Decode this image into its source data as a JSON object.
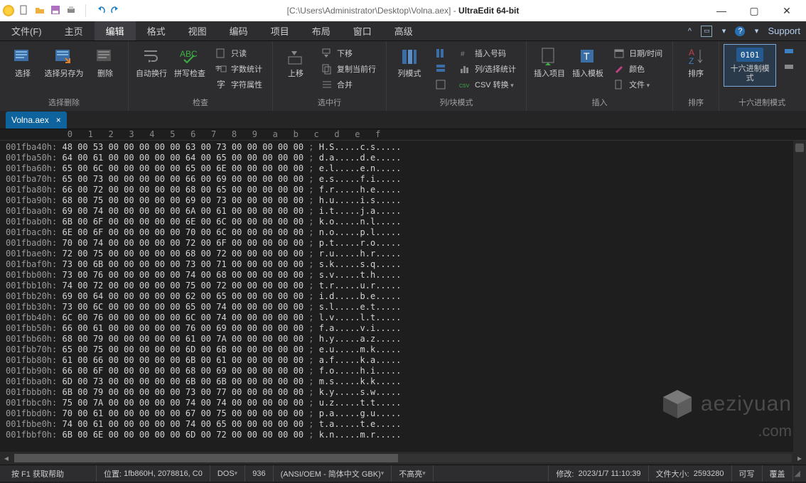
{
  "window": {
    "title_prefix": "[C:\\Users\\Administrator\\Desktop\\Volna.aex] - ",
    "app_name": "UltraEdit 64-bit"
  },
  "menutabs": {
    "items": [
      "文件(F)",
      "主页",
      "编辑",
      "格式",
      "视图",
      "编码",
      "项目",
      "布局",
      "窗口",
      "高级"
    ],
    "active_index": 2,
    "support": "Support"
  },
  "ribbon": {
    "group1": {
      "label": "选择删除",
      "select": "选择",
      "save_sel_as": "选择另存为",
      "delete": "删除"
    },
    "group2": {
      "label": "检查",
      "autowrap": "自动换行",
      "spell": "拼写检查",
      "readonly": "只读",
      "wordcount": "字数统计",
      "fontprop": "字符属性"
    },
    "group3": {
      "label": "选中行",
      "up": "上移",
      "down": "下移",
      "copy_cur": "复制当前行",
      "merge": "合并"
    },
    "group4": {
      "label": "列/块模式",
      "colmode": "列模式",
      "insert_num": "插入号码",
      "col_sel_stat": "列/选择统计",
      "csv_conv": "CSV 转换"
    },
    "group5": {
      "label": "插入",
      "insert_item": "插入项目",
      "insert_tmpl": "插入模板",
      "datetime": "日期/时间",
      "color": "颜色",
      "file": "文件"
    },
    "group6": {
      "label": "排序",
      "sort": "排序"
    },
    "group7": {
      "label": "十六进制模式",
      "hexmode": "十六进制模式",
      "hex_digits": "0101"
    }
  },
  "filetab": {
    "name": "Volna.aex"
  },
  "ruler": "            0   1   2   3   4   5   6   7   8   9   a   b   c   d   e   f",
  "hex_lines": [
    {
      "addr": "001fba40h:",
      "hex": "48 00 53 00 00 00 00 00 63 00 73 00 00 00 00 00",
      "asc": "H.S.....c.s....."
    },
    {
      "addr": "001fba50h:",
      "hex": "64 00 61 00 00 00 00 00 64 00 65 00 00 00 00 00",
      "asc": "d.a.....d.e....."
    },
    {
      "addr": "001fba60h:",
      "hex": "65 00 6C 00 00 00 00 00 65 00 6E 00 00 00 00 00",
      "asc": "e.l.....e.n....."
    },
    {
      "addr": "001fba70h:",
      "hex": "65 00 73 00 00 00 00 00 66 00 69 00 00 00 00 00",
      "asc": "e.s.....f.i....."
    },
    {
      "addr": "001fba80h:",
      "hex": "66 00 72 00 00 00 00 00 68 00 65 00 00 00 00 00",
      "asc": "f.r.....h.e....."
    },
    {
      "addr": "001fba90h:",
      "hex": "68 00 75 00 00 00 00 00 69 00 73 00 00 00 00 00",
      "asc": "h.u.....i.s....."
    },
    {
      "addr": "001fbaa0h:",
      "hex": "69 00 74 00 00 00 00 00 6A 00 61 00 00 00 00 00",
      "asc": "i.t.....j.a....."
    },
    {
      "addr": "001fbab0h:",
      "hex": "6B 00 6F 00 00 00 00 00 6E 00 6C 00 00 00 00 00",
      "asc": "k.o.....n.l....."
    },
    {
      "addr": "001fbac0h:",
      "hex": "6E 00 6F 00 00 00 00 00 70 00 6C 00 00 00 00 00",
      "asc": "n.o.....p.l....."
    },
    {
      "addr": "001fbad0h:",
      "hex": "70 00 74 00 00 00 00 00 72 00 6F 00 00 00 00 00",
      "asc": "p.t.....r.o....."
    },
    {
      "addr": "001fbae0h:",
      "hex": "72 00 75 00 00 00 00 00 68 00 72 00 00 00 00 00",
      "asc": "r.u.....h.r....."
    },
    {
      "addr": "001fbaf0h:",
      "hex": "73 00 6B 00 00 00 00 00 73 00 71 00 00 00 00 00",
      "asc": "s.k.....s.q....."
    },
    {
      "addr": "001fbb00h:",
      "hex": "73 00 76 00 00 00 00 00 74 00 68 00 00 00 00 00",
      "asc": "s.v.....t.h....."
    },
    {
      "addr": "001fbb10h:",
      "hex": "74 00 72 00 00 00 00 00 75 00 72 00 00 00 00 00",
      "asc": "t.r.....u.r....."
    },
    {
      "addr": "001fbb20h:",
      "hex": "69 00 64 00 00 00 00 00 62 00 65 00 00 00 00 00",
      "asc": "i.d.....b.e....."
    },
    {
      "addr": "001fbb30h:",
      "hex": "73 00 6C 00 00 00 00 00 65 00 74 00 00 00 00 00",
      "asc": "s.l.....e.t....."
    },
    {
      "addr": "001fbb40h:",
      "hex": "6C 00 76 00 00 00 00 00 6C 00 74 00 00 00 00 00",
      "asc": "l.v.....l.t....."
    },
    {
      "addr": "001fbb50h:",
      "hex": "66 00 61 00 00 00 00 00 76 00 69 00 00 00 00 00",
      "asc": "f.a.....v.i....."
    },
    {
      "addr": "001fbb60h:",
      "hex": "68 00 79 00 00 00 00 00 61 00 7A 00 00 00 00 00",
      "asc": "h.y.....a.z....."
    },
    {
      "addr": "001fbb70h:",
      "hex": "65 00 75 00 00 00 00 00 6D 00 6B 00 00 00 00 00",
      "asc": "e.u.....m.k....."
    },
    {
      "addr": "001fbb80h:",
      "hex": "61 00 66 00 00 00 00 00 6B 00 61 00 00 00 00 00",
      "asc": "a.f.....k.a....."
    },
    {
      "addr": "001fbb90h:",
      "hex": "66 00 6F 00 00 00 00 00 68 00 69 00 00 00 00 00",
      "asc": "f.o.....h.i....."
    },
    {
      "addr": "001fbba0h:",
      "hex": "6D 00 73 00 00 00 00 00 6B 00 6B 00 00 00 00 00",
      "asc": "m.s.....k.k....."
    },
    {
      "addr": "001fbbb0h:",
      "hex": "6B 00 79 00 00 00 00 00 73 00 77 00 00 00 00 00",
      "asc": "k.y.....s.w....."
    },
    {
      "addr": "001fbbc0h:",
      "hex": "75 00 7A 00 00 00 00 00 74 00 74 00 00 00 00 00",
      "asc": "u.z.....t.t....."
    },
    {
      "addr": "001fbbd0h:",
      "hex": "70 00 61 00 00 00 00 00 67 00 75 00 00 00 00 00",
      "asc": "p.a.....g.u....."
    },
    {
      "addr": "001fbbe0h:",
      "hex": "74 00 61 00 00 00 00 00 74 00 65 00 00 00 00 00",
      "asc": "t.a.....t.e....."
    },
    {
      "addr": "001fbbf0h:",
      "hex": "6B 00 6E 00 00 00 00 00 6D 00 72 00 00 00 00 00",
      "asc": "k.n.....m.r....."
    }
  ],
  "statusbar": {
    "help": "按 F1 获取帮助",
    "pos_label": "位置:",
    "pos_value": "1fb860H, 2078816, C0",
    "eol": "DOS",
    "codepage": "936",
    "encoding": "(ANSI/OEM - 简体中文 GBK)",
    "highlight": "不高亮",
    "modify_label": "修改:",
    "modify_value": "2023/1/7 11:10:39",
    "size_label": "文件大小:",
    "size_value": "2593280",
    "write": "可写",
    "overwrite": "覆盖"
  },
  "watermark": {
    "line1": "aeziyuan",
    "line2": ".com"
  }
}
